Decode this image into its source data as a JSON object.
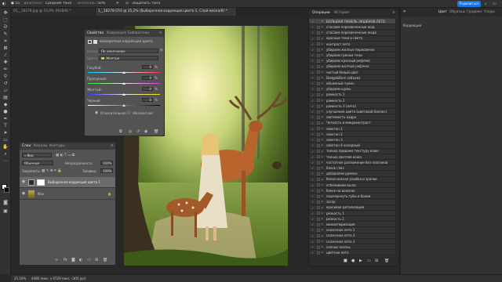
{
  "optbar": {
    "mode_label": "Диапазон:",
    "mode_value": "Средние тона",
    "exposure_label": "Экспонир.:",
    "exposure_value": "50%",
    "protect_label": "Защитить тона",
    "share_label": "Поделиться"
  },
  "tabs": [
    {
      "label": "01__18278.jpg @ 15,9% (RGB/8) *"
    },
    {
      "label": "1__18278.CR3 @ 25,2% (Выборочная коррекция цвета 1, Слой-маска/8) *"
    }
  ],
  "properties": {
    "tabs": [
      "Свойства",
      "Коррекция",
      "Библиотеки"
    ],
    "title": "Выборочная коррекция цвета",
    "preset_label": "Набор:",
    "preset_value": "По умолчанию",
    "colors_label": "Цвета:",
    "colors_value": "Желтые",
    "sliders": [
      {
        "label": "Голубой:",
        "value": "0",
        "unit": "%"
      },
      {
        "label": "Пурпурный:",
        "value": "0",
        "unit": "%"
      },
      {
        "label": "Желтый:",
        "value": "0",
        "unit": "%"
      },
      {
        "label": "Черный:",
        "value": "0",
        "unit": "%"
      }
    ],
    "method_relative": "Относительная",
    "method_absolute": "Абсолютная"
  },
  "layers": {
    "tabs": [
      "Слои",
      "Каналы",
      "Контуры"
    ],
    "search_placeholder": "Вид",
    "blend_mode": "Обычные",
    "opacity_label": "Непрозрачность:",
    "opacity_value": "100%",
    "lock_label": "Закрепить:",
    "fill_label": "Заливка:",
    "fill_value": "100%",
    "items": [
      {
        "name": "Выборочная коррекция цвета 1"
      },
      {
        "name": "Фон"
      }
    ]
  },
  "actions_panel": {
    "tabs": [
      "Операции",
      "История"
    ],
    "items": [
      "БОЛЬШАЯ ПАНЕЛЬ ЭКШЕНОВ ЛЕТО",
      "спасаем пересвеченные жад",
      "спасаем пересвеченные жадо",
      "красные тени и света",
      "контраст лето",
      "убираем желтые пересвечен",
      "убираем греные тени",
      "убираем красный рефлекс",
      "убираем желтый рефлекс",
      "чистый белый цвет",
      "Dodge&Burn (объем)",
      "объемный тумен",
      "убираем шумы",
      "рамкость 1",
      "рамкость 2",
      "рамкость 3 (лето)",
      "улучшение цвета (цветовой баланс)",
      "светимость кадра",
      "Четкость и микроконтраст",
      "свектон 1",
      "свектон 2",
      "свектон 3",
      "свектон 4 холодный",
      "только придаем текстуру коже",
      "только светлая кожа",
      "частотное разложение без плагинов",
      "блеск глаз",
      "добавляем румяна",
      "белоснежная улыбка и зрачки",
      "отбеливаем волос",
      "блеск на волосах",
      "подчеркнуть губы и брови",
      "загар",
      "красивая детализация",
      "резкость 1",
      "резкость 2",
      "миниатюризация",
      "сказочное лето 1",
      "сказочное лето 2",
      "сказочное лето 3",
      "солнце зелень",
      "цветное лето"
    ]
  },
  "rightdock": {
    "tabs": [
      "Цвет",
      "Образцы",
      "Градиен",
      "Узоры"
    ],
    "section": "Коррекция"
  },
  "status": {
    "zoom": "25,16%",
    "doc_info": "4480 пикс. x 6720 пикс. (300 ppi)"
  }
}
